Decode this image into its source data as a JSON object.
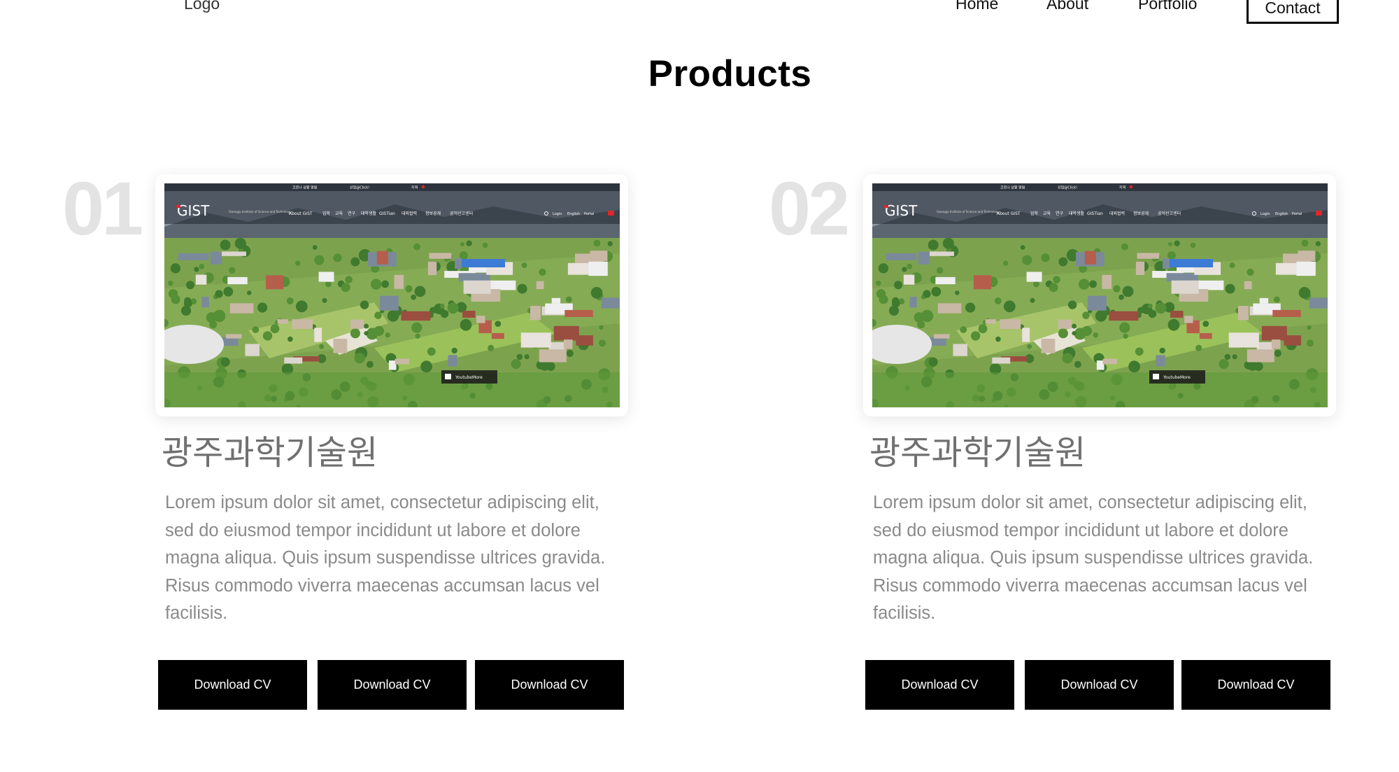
{
  "header": {
    "logo": "Logo",
    "nav": [
      "Home",
      "About",
      "Portfolio"
    ],
    "contact": "Contact"
  },
  "section": {
    "title": "Products"
  },
  "products": [
    {
      "index": "01",
      "title": "광주과학기술원",
      "description": "Lorem ipsum dolor sit amet, consectetur adipiscing elit, sed do eiusmod tempor incididunt ut labore et dolore magna aliqua. Quis ipsum suspendisse ultrices gravida. Risus commodo viverra maecenas accumsan lacus vel facilisis.",
      "buttons": [
        "Download CV",
        "Download CV",
        "Download CV"
      ],
      "screenshot": {
        "brand": "GIST",
        "brand_sub": "Gwangju Institute of Science and Technology",
        "menu": [
          "About GIST",
          "입학",
          "교육",
          "연구",
          "대학생활",
          "GISTian",
          "대외협력",
          "정보공개",
          "공익신고센터"
        ],
        "top_links": [
          "코로나 상황 알림",
          "산업@Click!",
          "지역"
        ],
        "utility_links": [
          "Login",
          "English",
          "Portal"
        ],
        "video_label": "YoutubeMore"
      }
    },
    {
      "index": "02",
      "title": "광주과학기술원",
      "description": "Lorem ipsum dolor sit amet, consectetur adipiscing elit, sed do eiusmod tempor incididunt ut labore et dolore magna aliqua. Quis ipsum suspendisse ultrices gravida. Risus commodo viverra maecenas accumsan lacus vel facilisis.",
      "buttons": [
        "Download CV",
        "Download CV",
        "Download CV"
      ],
      "screenshot": {
        "brand": "GIST",
        "brand_sub": "Gwangju Institute of Science and Technology",
        "menu": [
          "About GIST",
          "입학",
          "교육",
          "연구",
          "대학생활",
          "GISTian",
          "대외협력",
          "정보공개",
          "공익신고센터"
        ],
        "top_links": [
          "코로나 상황 알림",
          "산업@Click!",
          "지역"
        ],
        "utility_links": [
          "Login",
          "English",
          "Portal"
        ],
        "video_label": "YoutubeMore"
      }
    }
  ],
  "colors": {
    "index": "#e3e3e3",
    "button": "#000000",
    "brand_accent": "#e0262b"
  }
}
